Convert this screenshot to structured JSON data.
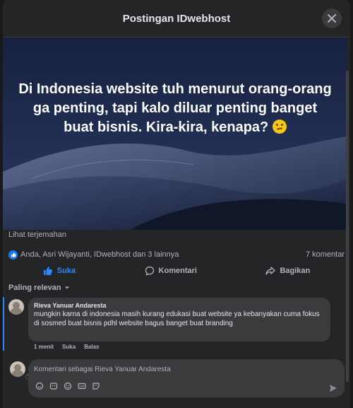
{
  "header": {
    "title": "Postingan IDwebhost"
  },
  "post": {
    "text_main": "Di Indonesia website tuh menurut orang-orang ga penting, tapi kalo diluar penting banget buat bisnis. Kira-kira, kenapa?",
    "emoji": "thinking-face",
    "translate_link": "Lihat terjemahan"
  },
  "reactions": {
    "summary": "Anda, Asri Wijayanti, IDwebhost dan 3 lainnya",
    "comment_count": "7 komentar"
  },
  "actions": {
    "like_label": "Suka",
    "comment_label": "Komentari",
    "share_label": "Bagikan"
  },
  "comments_sort": {
    "label": "Paling relevan"
  },
  "comment": {
    "author": "Rieva Yanuar Andaresta",
    "body": "mungkin karna di indonesia masih kurang edukasi buat website ya kebanyakan cuma fokus di sosmed buat bisnis pdhl website bagus banget buat branding",
    "time": "1 menit",
    "like_label": "Suka",
    "reply_label": "Balas"
  },
  "composer": {
    "placeholder": "Komentari sebagai Rieva Yanuar Andaresta",
    "tools": [
      "sticker-icon",
      "avatar-sticker-icon",
      "emoji-icon",
      "gif-icon",
      "sticker2-icon"
    ]
  },
  "colors": {
    "accent": "#2d88ff",
    "bg": "#242526",
    "bubble": "#3a3b3c"
  }
}
